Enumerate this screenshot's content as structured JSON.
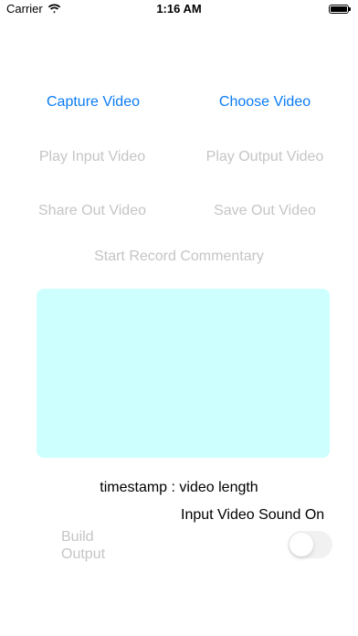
{
  "status_bar": {
    "carrier": "Carrier",
    "time": "1:16 AM",
    "wifi_icon": "wifi-icon",
    "battery_level": 1.0
  },
  "buttons": {
    "capture_video": "Capture Video",
    "choose_video": "Choose Video",
    "play_input_video": "Play Input Video",
    "play_output_video": "Play Output Video",
    "share_out_video": "Share Out Video",
    "save_out_video": "Save Out Video",
    "start_record_commentary": "Start Record Commentary"
  },
  "timestamp_label": "timestamp : video length",
  "sound_label": "Input Video Sound On",
  "build_output_label": "Build Output",
  "toggle": {
    "on": false,
    "enabled": false
  },
  "colors": {
    "accent": "#0a7cf6",
    "disabled_text": "#c5c5c7",
    "preview_background": "#ccfffe",
    "toggle_off": "#e9e9eb"
  }
}
